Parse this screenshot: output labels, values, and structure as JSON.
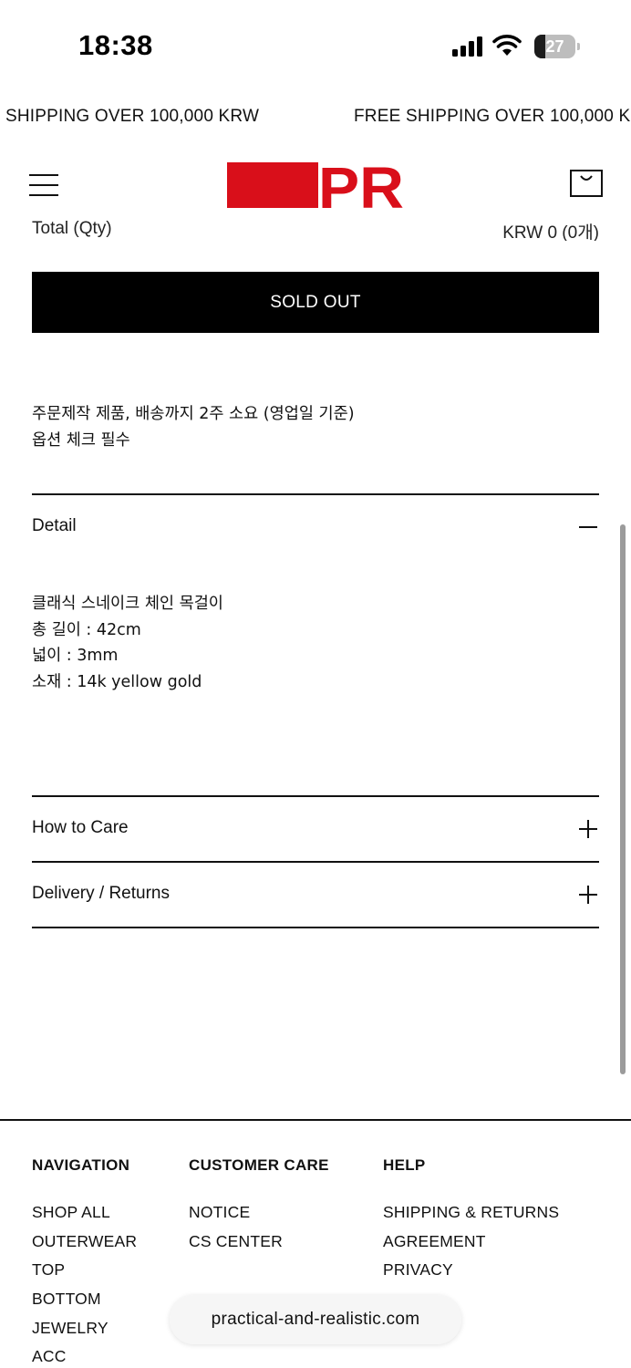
{
  "status_bar": {
    "time": "18:38",
    "battery_level": "27",
    "battery_fraction": 0.27
  },
  "marquee": {
    "items": [
      "SHIPPING OVER 100,000 KRW",
      "FREE SHIPPING OVER 100,000 K"
    ]
  },
  "header": {
    "logo_text": "PR",
    "brand_color": "#d90f1a",
    "icons": [
      "menu-icon",
      "cart-icon"
    ]
  },
  "product": {
    "total_label": "Total (Qty)",
    "total_value": "KRW 0 (0개)",
    "sold_out_label": "SOLD OUT",
    "notice_lines": [
      "주문제작 제품, 배송까지 2주 소요 (영업일 기준)",
      "옵션 체크 필수"
    ]
  },
  "accordion": [
    {
      "title": "Detail",
      "state": "expanded",
      "icon": "minus-icon",
      "body": [
        "클래식 스네이크 체인 목걸이",
        "총 길이 : 42cm",
        "넓이 : 3mm",
        "소재 : 14k yellow gold"
      ]
    },
    {
      "title": "How to Care",
      "state": "collapsed",
      "icon": "plus-icon"
    },
    {
      "title": "Delivery / Returns",
      "state": "collapsed",
      "icon": "plus-icon"
    }
  ],
  "footer": {
    "columns": [
      {
        "heading": "NAVIGATION",
        "links": [
          "SHOP ALL",
          "OUTERWEAR",
          "TOP",
          "BOTTOM",
          "JEWELRY",
          "ACC"
        ]
      },
      {
        "heading": "CUSTOMER CARE",
        "links": [
          "NOTICE",
          "CS CENTER"
        ]
      },
      {
        "heading": "HELP",
        "links": [
          "SHIPPING & RETURNS",
          "AGREEMENT",
          "PRIVACY"
        ]
      }
    ]
  },
  "browser": {
    "url": "practical-and-realistic.com"
  }
}
